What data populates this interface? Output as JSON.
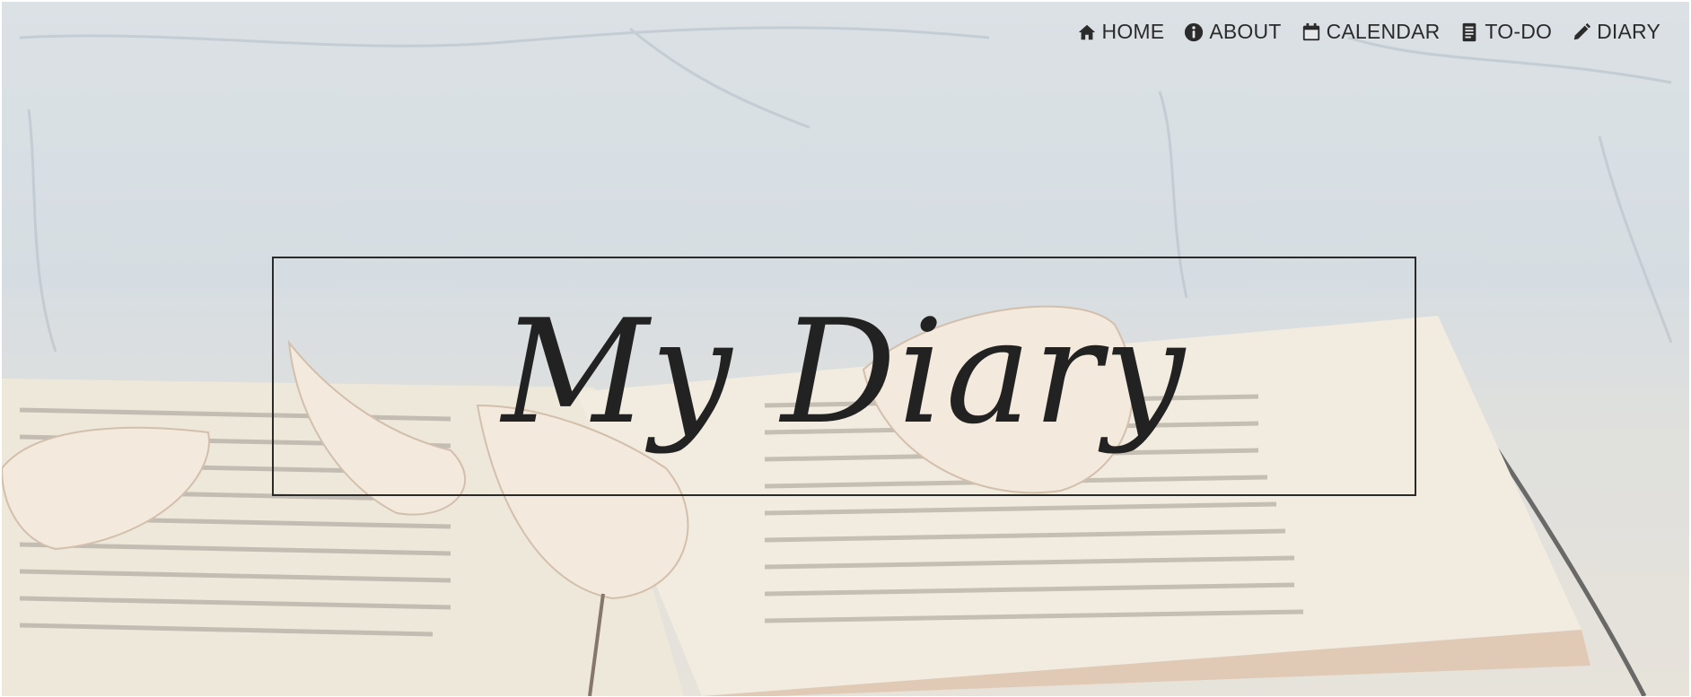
{
  "nav": {
    "items": [
      {
        "label": "HOME",
        "icon": "home-icon"
      },
      {
        "label": "ABOUT",
        "icon": "info-icon"
      },
      {
        "label": "CALENDAR",
        "icon": "calendar-icon"
      },
      {
        "label": "TO-DO",
        "icon": "list-icon"
      },
      {
        "label": "DIARY",
        "icon": "pencil-icon"
      }
    ]
  },
  "hero": {
    "title": "My Diary",
    "background": "open-book-with-petals",
    "text_color": "#222222"
  }
}
